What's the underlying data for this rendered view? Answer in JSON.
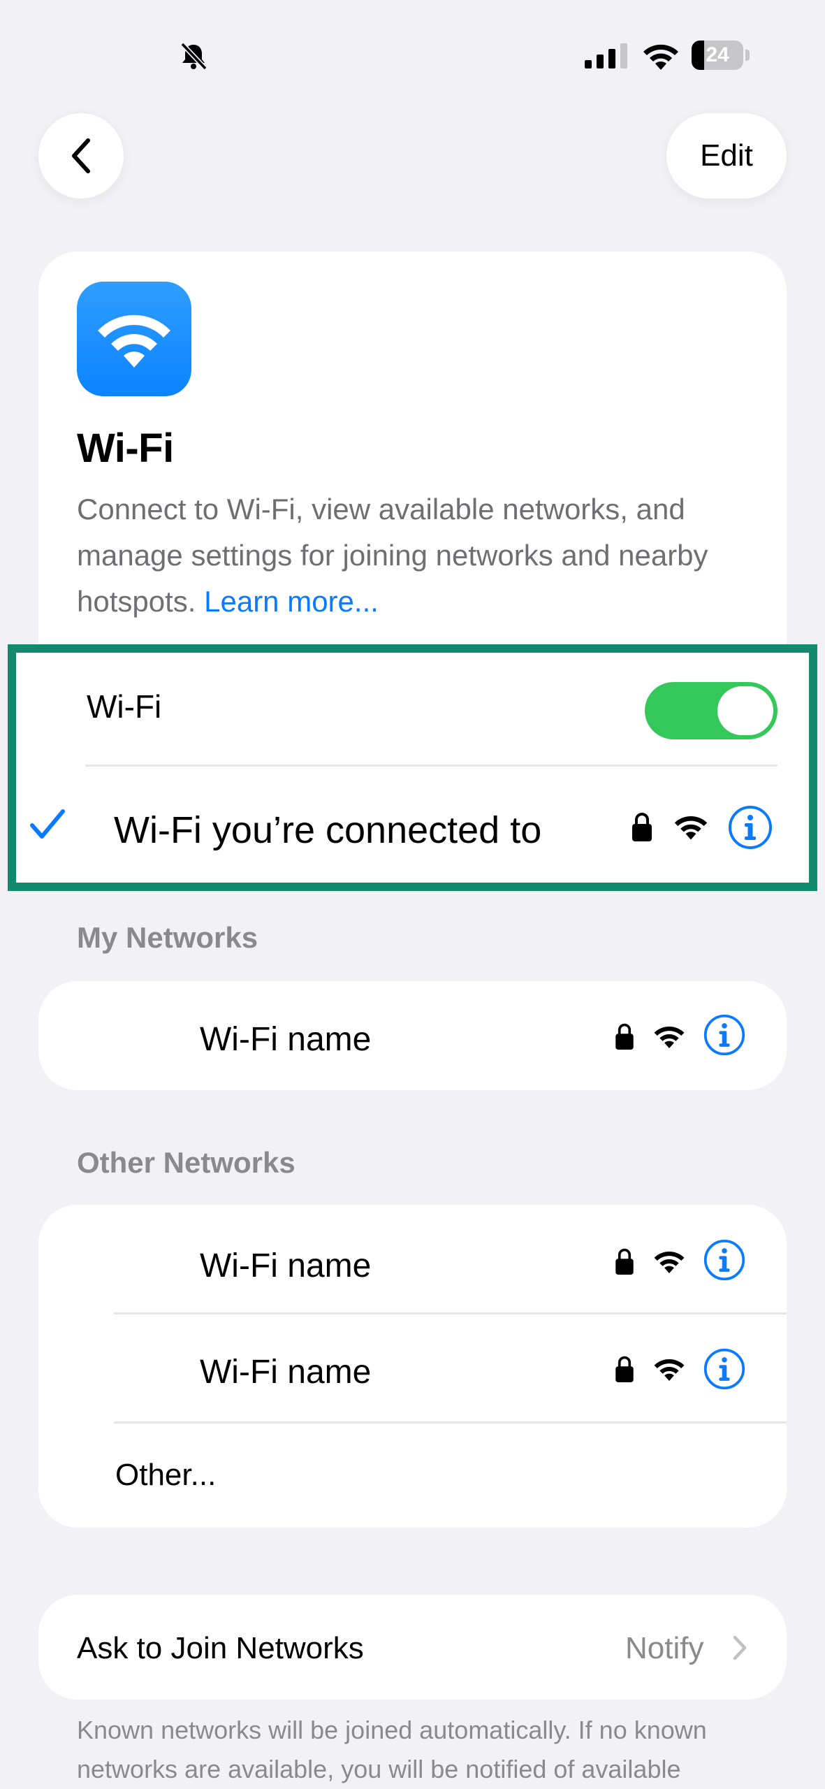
{
  "status_bar": {
    "battery_level": "24",
    "battery_fraction": 0.24
  },
  "nav": {
    "edit_label": "Edit"
  },
  "header": {
    "title": "Wi-Fi",
    "description": "Connect to Wi-Fi, view available networks, and manage settings for joining networks and nearby hotspots.",
    "learn_more": "Learn more..."
  },
  "wifi_toggle": {
    "label": "Wi-Fi",
    "on": true
  },
  "connected_network": {
    "name": "Wi-Fi you’re connected to"
  },
  "my_networks": {
    "header": "My Networks",
    "items": [
      {
        "name": "Wi-Fi name"
      }
    ]
  },
  "other_networks": {
    "header": "Other Networks",
    "items": [
      {
        "name": "Wi-Fi name"
      },
      {
        "name": "Wi-Fi name"
      }
    ],
    "other_label": "Other..."
  },
  "ask_to_join": {
    "label": "Ask to Join Networks",
    "value": "Notify"
  },
  "footer": {
    "text": "Known networks will be joined automatically. If no known networks are available, you will be notified of available"
  },
  "colors": {
    "accent": "#0a7aff",
    "toggle_on": "#34c759",
    "highlight": "#138a6e",
    "background": "#f2f2f6"
  },
  "icons": [
    "bell-slash-icon",
    "cellular-signal-icon",
    "wifi-icon",
    "battery-icon",
    "chevron-left-icon",
    "checkmark-icon",
    "lock-icon",
    "info-icon",
    "chevron-right-icon"
  ]
}
